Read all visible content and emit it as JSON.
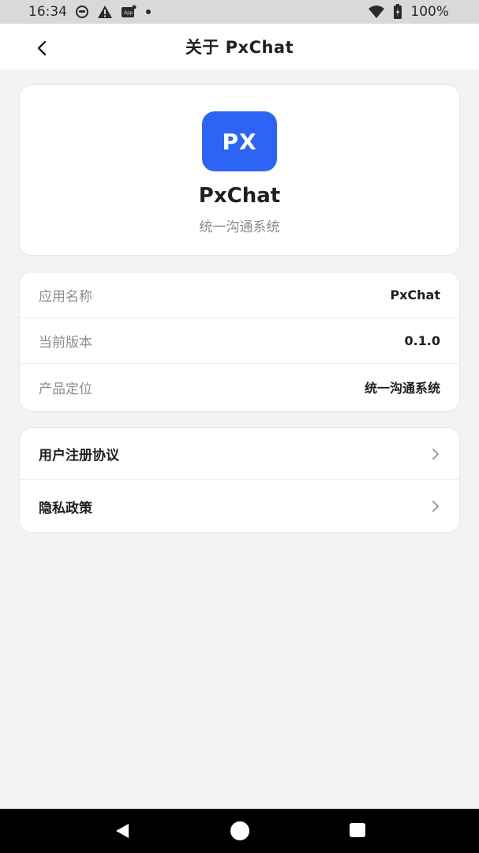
{
  "status_bar": {
    "time": "16:34",
    "battery": "100%",
    "icons": [
      "face-icon",
      "warning-icon",
      "app-icon",
      "dot-icon",
      "wifi-icon",
      "battery-icon"
    ]
  },
  "header": {
    "back_icon": "chevron-left-icon",
    "title": "关于 PxChat"
  },
  "hero": {
    "logo_text": "PX",
    "logo_color": "#2e64f6",
    "app_name": "PxChat",
    "tagline": "统一沟通系统"
  },
  "info": {
    "rows": [
      {
        "label": "应用名称",
        "value": "PxChat"
      },
      {
        "label": "当前版本",
        "value": "0.1.0"
      },
      {
        "label": "产品定位",
        "value": "统一沟通系统"
      }
    ]
  },
  "links": {
    "items": [
      {
        "label": "用户注册协议",
        "icon": "chevron-right-icon"
      },
      {
        "label": "隐私政策",
        "icon": "chevron-right-icon"
      }
    ]
  },
  "system_nav": {
    "buttons": [
      "back-triangle-icon",
      "home-circle-icon",
      "recents-square-icon"
    ]
  }
}
